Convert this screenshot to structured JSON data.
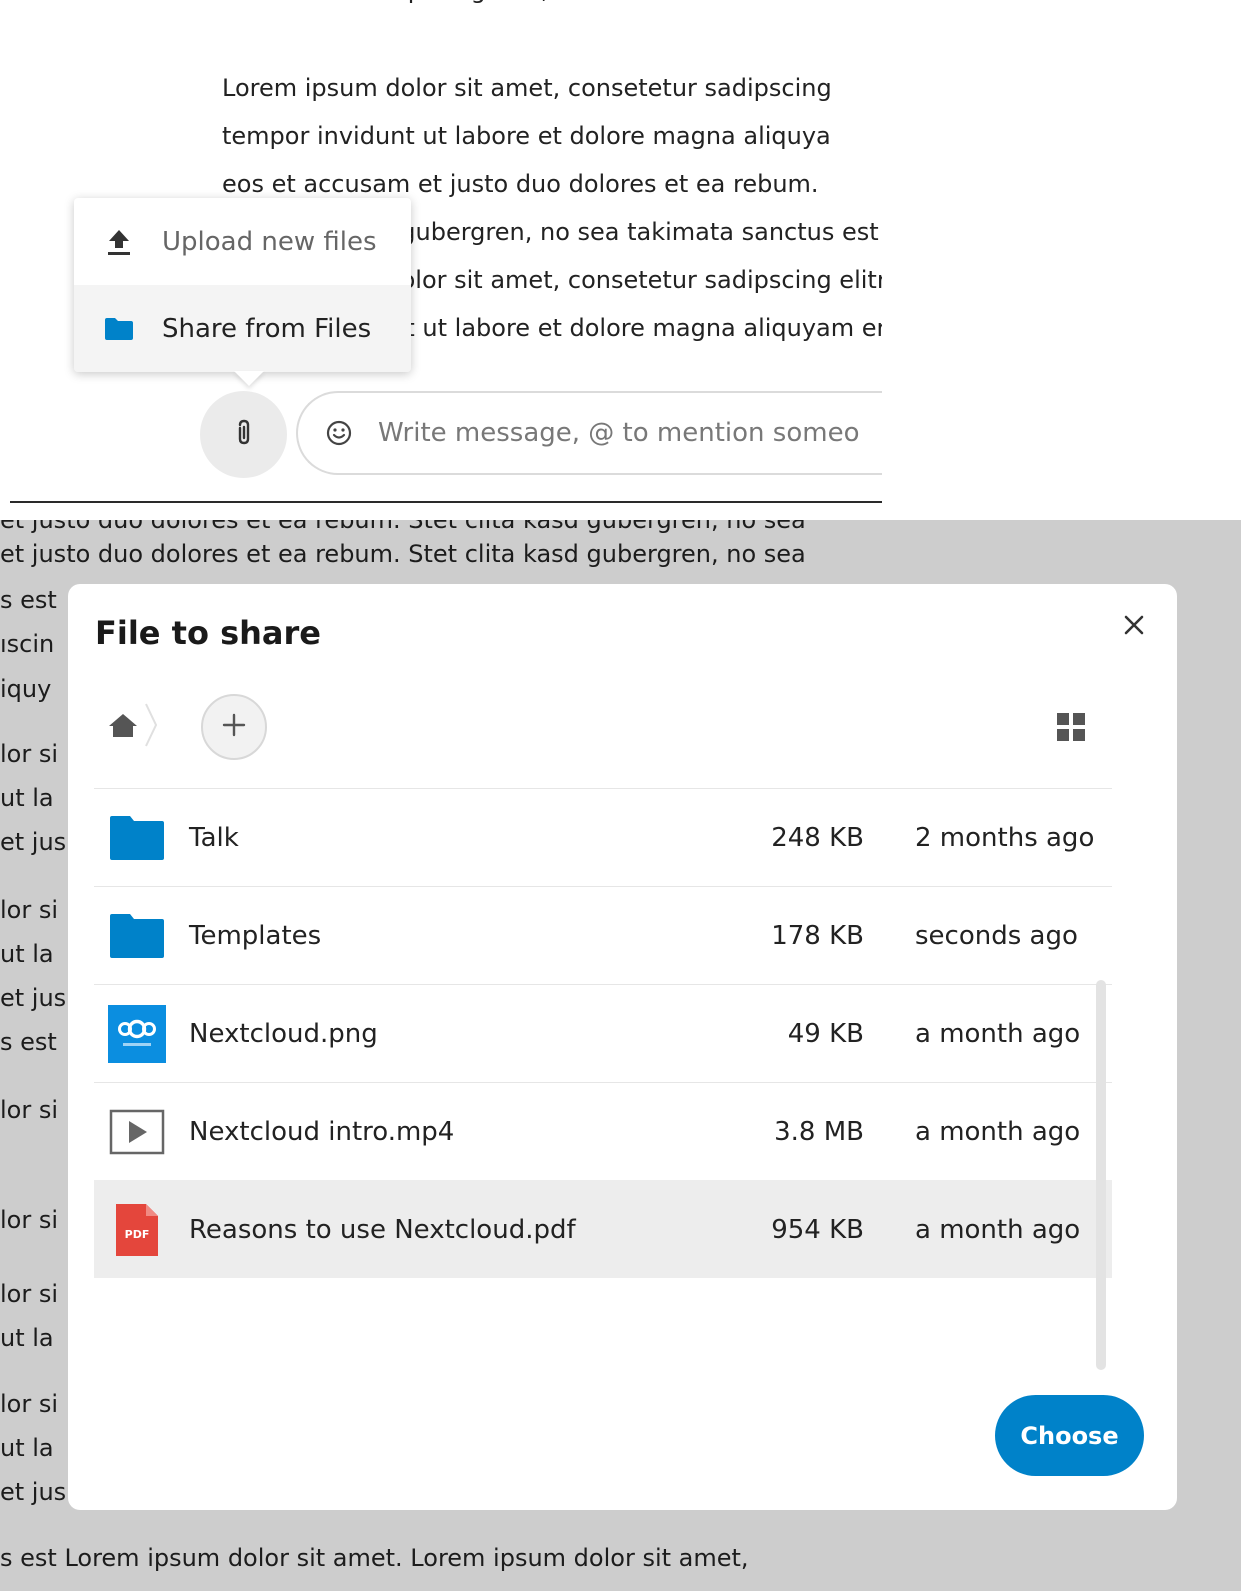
{
  "chat_background": {
    "cut_line": "consetetur sadipscing elitr, sed diam nonu",
    "paragraph_lines": [
      "Lorem ipsum dolor sit amet, consetetur sadipscing",
      "tempor invidunt ut labore et dolore magna aliquya",
      "eos et accusam et justo duo dolores et ea rebum.",
      "Stet clita kasd gubergren, no sea takimata sanctus est Lorem ipsum dolor sit amet.",
      "Lorem ipsum dolor sit amet, consetetur sadipscing elitr, sed diam nonumy eirm",
      "tempor invidunt ut labore et dolore magna aliquyam erat, sed diam voluptua. A"
    ]
  },
  "attachment_menu": {
    "items": [
      {
        "label": "Upload new files",
        "icon": "upload-icon"
      },
      {
        "label": "Share from Files",
        "icon": "folder-icon"
      }
    ]
  },
  "composer": {
    "placeholder": "Write message, @ to mention someo",
    "attach_icon": "paperclip-icon",
    "emoji_icon": "emoji-icon"
  },
  "background_text": {
    "top_line_cut": "et justo duo dolores et ea rebum. Stet clita kasd gubergren, no sea",
    "main_line": "et justo duo dolores et ea rebum. Stet clita kasd gubergren, no sea",
    "left_fragments": [
      "s est",
      "ıscin",
      "iquy",
      "lor si",
      "ut la",
      "et jus",
      "lor si",
      "ut la",
      "et jus",
      "s est",
      "lor si",
      "lor si",
      "lor si",
      "ut la",
      "lor si",
      "ut la",
      "et jus"
    ],
    "bottom_line": "s est Lorem ipsum dolor sit amet. Lorem ipsum dolor sit amet,"
  },
  "dialog": {
    "title": "File to share",
    "close_icon": "close-icon",
    "breadcrumb_home_icon": "home-icon",
    "new_folder_icon": "plus-icon",
    "view_toggle_icon": "grid-view-icon",
    "choose_label": "Choose",
    "accent_color": "#0082c9",
    "files": [
      {
        "name": "Talk",
        "size": "248 KB",
        "modified": "2 months ago",
        "type": "folder",
        "selected": false
      },
      {
        "name": "Templates",
        "size": "178 KB",
        "modified": "seconds ago",
        "type": "folder",
        "selected": false
      },
      {
        "name": "Nextcloud.png",
        "size": "49 KB",
        "modified": "a month ago",
        "type": "image",
        "selected": false
      },
      {
        "name": "Nextcloud intro.mp4",
        "size": "3.8 MB",
        "modified": "a month ago",
        "type": "video",
        "selected": false
      },
      {
        "name": "Reasons to use Nextcloud.pdf",
        "size": "954 KB",
        "modified": "a month ago",
        "type": "pdf",
        "selected": true
      }
    ],
    "pdf_badge": "PDF"
  }
}
